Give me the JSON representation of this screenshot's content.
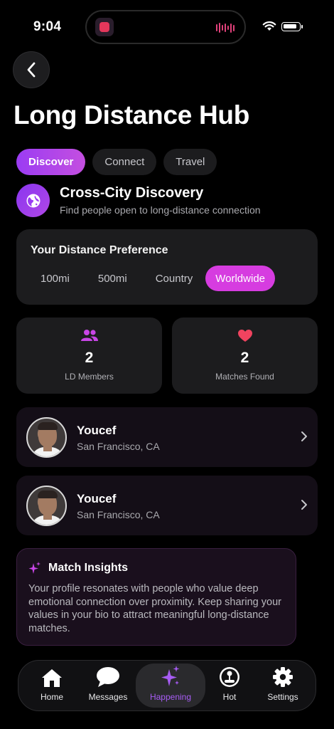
{
  "status_bar": {
    "time": "9:04"
  },
  "header": {
    "title": "Long Distance Hub"
  },
  "tabs": [
    {
      "label": "Discover",
      "active": true
    },
    {
      "label": "Connect",
      "active": false
    },
    {
      "label": "Travel",
      "active": false
    }
  ],
  "section": {
    "icon": "globe-icon",
    "title": "Cross-City Discovery",
    "subtitle": "Find people open to long-distance connection"
  },
  "distance_preference": {
    "title": "Your Distance Preference",
    "options": [
      "100mi",
      "500mi",
      "Country",
      "Worldwide"
    ],
    "selected": "Worldwide"
  },
  "stats": [
    {
      "icon": "people-icon",
      "value": "2",
      "label": "LD Members"
    },
    {
      "icon": "heart-icon",
      "value": "2",
      "label": "Matches Found"
    }
  ],
  "people": [
    {
      "name": "Youcef",
      "location": "San Francisco, CA"
    },
    {
      "name": "Youcef",
      "location": "San Francisco, CA"
    }
  ],
  "insights": {
    "icon": "sparkle-icon",
    "title": "Match Insights",
    "body": "Your profile resonates with people who value deep emotional connection over proximity. Keep sharing your values in your bio to attract meaningful long-distance matches."
  },
  "bottom_nav": [
    {
      "label": "Home",
      "icon": "home-icon",
      "active": false
    },
    {
      "label": "Messages",
      "icon": "chat-bubble-icon",
      "active": false
    },
    {
      "label": "Happening",
      "icon": "sparkle-icon",
      "active": true
    },
    {
      "label": "Hot",
      "icon": "joystick-icon",
      "active": false
    },
    {
      "label": "Settings",
      "icon": "gear-icon",
      "active": false
    }
  ],
  "colors": {
    "background": "#000000",
    "card": "#1c1c1e",
    "accent_purple": "#9b3cf3",
    "accent_magenta": "#d63ce0",
    "heart": "#f0435f"
  }
}
